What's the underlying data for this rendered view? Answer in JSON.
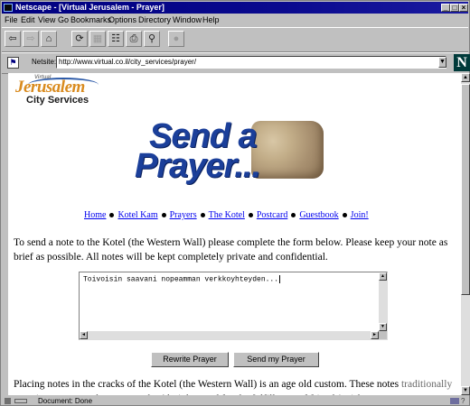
{
  "window": {
    "title": "Netscape - [Virtual Jerusalem - Prayer]",
    "controls": [
      "_",
      "□",
      "×"
    ]
  },
  "menu": [
    "File",
    "Edit",
    "View",
    "Go",
    "Bookmarks",
    "Options",
    "Directory",
    "Window",
    "Help"
  ],
  "toolbar": {
    "buttons": [
      {
        "icon": "back-icon"
      },
      {
        "icon": "forward-icon"
      },
      {
        "icon": "home-icon"
      },
      {
        "icon": "reload-icon"
      },
      {
        "icon": "images-icon"
      },
      {
        "icon": "open-icon"
      },
      {
        "icon": "print-icon"
      },
      {
        "icon": "find-icon"
      },
      {
        "icon": "stop-icon"
      }
    ]
  },
  "location": {
    "label": "Netsite:",
    "url": "http://www.virtual.co.il/city_services/prayer/"
  },
  "logo": {
    "top_small": "Virtual",
    "name": "Jerusalem",
    "sub": "City Services"
  },
  "banner": {
    "line1": "Send a",
    "line2": "Prayer..."
  },
  "nav": [
    "Home",
    "Kotel Kam",
    "Prayers",
    "The Kotel",
    "Postcard",
    "Guestbook",
    "Join!"
  ],
  "intro_text": "To send a note to the Kotel (the Western Wall) please complete the form below. Please keep your note as brief as possible. All notes will be kept completely private and confidential.",
  "form": {
    "prayer_value": "Toivoisin saavani nopeamman verkkoyhteyden...",
    "rewrite_label": "Rewrite Prayer",
    "send_label": "Send my Prayer"
  },
  "closing_text": "Placing notes in the cracks of the Kotel (the Western Wall) is an age old custom. These notes",
  "closing_cut": "traditionally contain requests and prayers to the Almighty, and for the fulfillment of friends' wishes",
  "status": {
    "text": "Document: Done"
  }
}
